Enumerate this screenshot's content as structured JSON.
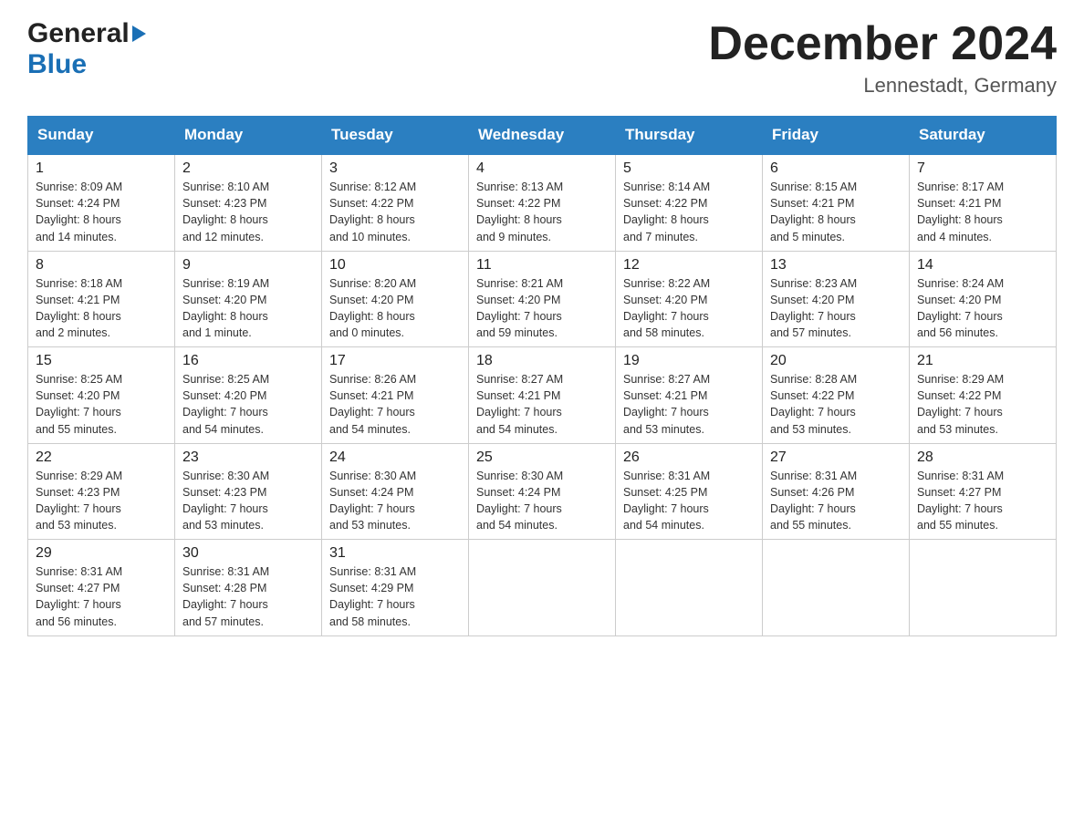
{
  "header": {
    "title": "December 2024",
    "subtitle": "Lennestadt, Germany",
    "logo_general": "General",
    "logo_blue": "Blue"
  },
  "days_of_week": [
    "Sunday",
    "Monday",
    "Tuesday",
    "Wednesday",
    "Thursday",
    "Friday",
    "Saturday"
  ],
  "weeks": [
    [
      {
        "day": "1",
        "sunrise": "8:09 AM",
        "sunset": "4:24 PM",
        "daylight": "8 hours and 14 minutes."
      },
      {
        "day": "2",
        "sunrise": "8:10 AM",
        "sunset": "4:23 PM",
        "daylight": "8 hours and 12 minutes."
      },
      {
        "day": "3",
        "sunrise": "8:12 AM",
        "sunset": "4:22 PM",
        "daylight": "8 hours and 10 minutes."
      },
      {
        "day": "4",
        "sunrise": "8:13 AM",
        "sunset": "4:22 PM",
        "daylight": "8 hours and 9 minutes."
      },
      {
        "day": "5",
        "sunrise": "8:14 AM",
        "sunset": "4:22 PM",
        "daylight": "8 hours and 7 minutes."
      },
      {
        "day": "6",
        "sunrise": "8:15 AM",
        "sunset": "4:21 PM",
        "daylight": "8 hours and 5 minutes."
      },
      {
        "day": "7",
        "sunrise": "8:17 AM",
        "sunset": "4:21 PM",
        "daylight": "8 hours and 4 minutes."
      }
    ],
    [
      {
        "day": "8",
        "sunrise": "8:18 AM",
        "sunset": "4:21 PM",
        "daylight": "8 hours and 2 minutes."
      },
      {
        "day": "9",
        "sunrise": "8:19 AM",
        "sunset": "4:20 PM",
        "daylight": "8 hours and 1 minute."
      },
      {
        "day": "10",
        "sunrise": "8:20 AM",
        "sunset": "4:20 PM",
        "daylight": "8 hours and 0 minutes."
      },
      {
        "day": "11",
        "sunrise": "8:21 AM",
        "sunset": "4:20 PM",
        "daylight": "7 hours and 59 minutes."
      },
      {
        "day": "12",
        "sunrise": "8:22 AM",
        "sunset": "4:20 PM",
        "daylight": "7 hours and 58 minutes."
      },
      {
        "day": "13",
        "sunrise": "8:23 AM",
        "sunset": "4:20 PM",
        "daylight": "7 hours and 57 minutes."
      },
      {
        "day": "14",
        "sunrise": "8:24 AM",
        "sunset": "4:20 PM",
        "daylight": "7 hours and 56 minutes."
      }
    ],
    [
      {
        "day": "15",
        "sunrise": "8:25 AM",
        "sunset": "4:20 PM",
        "daylight": "7 hours and 55 minutes."
      },
      {
        "day": "16",
        "sunrise": "8:25 AM",
        "sunset": "4:20 PM",
        "daylight": "7 hours and 54 minutes."
      },
      {
        "day": "17",
        "sunrise": "8:26 AM",
        "sunset": "4:21 PM",
        "daylight": "7 hours and 54 minutes."
      },
      {
        "day": "18",
        "sunrise": "8:27 AM",
        "sunset": "4:21 PM",
        "daylight": "7 hours and 54 minutes."
      },
      {
        "day": "19",
        "sunrise": "8:27 AM",
        "sunset": "4:21 PM",
        "daylight": "7 hours and 53 minutes."
      },
      {
        "day": "20",
        "sunrise": "8:28 AM",
        "sunset": "4:22 PM",
        "daylight": "7 hours and 53 minutes."
      },
      {
        "day": "21",
        "sunrise": "8:29 AM",
        "sunset": "4:22 PM",
        "daylight": "7 hours and 53 minutes."
      }
    ],
    [
      {
        "day": "22",
        "sunrise": "8:29 AM",
        "sunset": "4:23 PM",
        "daylight": "7 hours and 53 minutes."
      },
      {
        "day": "23",
        "sunrise": "8:30 AM",
        "sunset": "4:23 PM",
        "daylight": "7 hours and 53 minutes."
      },
      {
        "day": "24",
        "sunrise": "8:30 AM",
        "sunset": "4:24 PM",
        "daylight": "7 hours and 53 minutes."
      },
      {
        "day": "25",
        "sunrise": "8:30 AM",
        "sunset": "4:24 PM",
        "daylight": "7 hours and 54 minutes."
      },
      {
        "day": "26",
        "sunrise": "8:31 AM",
        "sunset": "4:25 PM",
        "daylight": "7 hours and 54 minutes."
      },
      {
        "day": "27",
        "sunrise": "8:31 AM",
        "sunset": "4:26 PM",
        "daylight": "7 hours and 55 minutes."
      },
      {
        "day": "28",
        "sunrise": "8:31 AM",
        "sunset": "4:27 PM",
        "daylight": "7 hours and 55 minutes."
      }
    ],
    [
      {
        "day": "29",
        "sunrise": "8:31 AM",
        "sunset": "4:27 PM",
        "daylight": "7 hours and 56 minutes."
      },
      {
        "day": "30",
        "sunrise": "8:31 AM",
        "sunset": "4:28 PM",
        "daylight": "7 hours and 57 minutes."
      },
      {
        "day": "31",
        "sunrise": "8:31 AM",
        "sunset": "4:29 PM",
        "daylight": "7 hours and 58 minutes."
      },
      null,
      null,
      null,
      null
    ]
  ],
  "labels": {
    "sunrise": "Sunrise:",
    "sunset": "Sunset:",
    "daylight": "Daylight:"
  }
}
